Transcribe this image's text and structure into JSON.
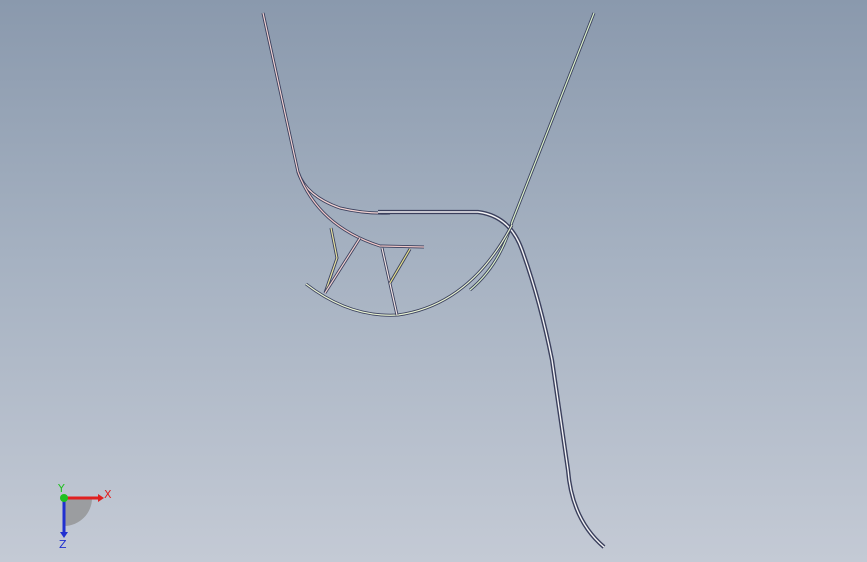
{
  "viewport": {
    "background_top": "#8a99ad",
    "background_bottom": "#c4cad5"
  },
  "model": {
    "edge_dark_color": "#3a3f5c",
    "edge_light_color": "#f4f4f6",
    "highlight_red": "#d98a8a",
    "highlight_yellow": "#e4e08a",
    "highlight_green": "#bfe3b0"
  },
  "triad": {
    "x_label": "X",
    "y_label": "Y",
    "z_label": "Z",
    "x_color": "#e02020",
    "y_color": "#20c020",
    "z_color": "#2030d0"
  }
}
